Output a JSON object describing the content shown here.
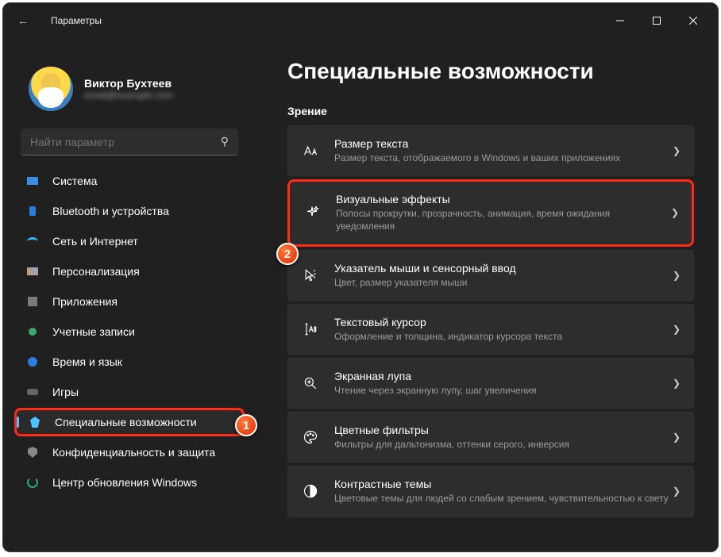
{
  "window": {
    "title": "Параметры"
  },
  "user": {
    "name": "Виктор Бухтеев",
    "email": "email@example.com"
  },
  "search": {
    "placeholder": "Найти параметр"
  },
  "sidebar": {
    "items": [
      {
        "label": "Система"
      },
      {
        "label": "Bluetooth и устройства"
      },
      {
        "label": "Сеть и Интернет"
      },
      {
        "label": "Персонализация"
      },
      {
        "label": "Приложения"
      },
      {
        "label": "Учетные записи"
      },
      {
        "label": "Время и язык"
      },
      {
        "label": "Игры"
      },
      {
        "label": "Специальные возможности"
      },
      {
        "label": "Конфиденциальность и защита"
      },
      {
        "label": "Центр обновления Windows"
      }
    ]
  },
  "page": {
    "heading": "Специальные возможности",
    "section": "Зрение",
    "cards": [
      {
        "title": "Размер текста",
        "sub": "Размер текста, отображаемого в Windows и ваших приложениях"
      },
      {
        "title": "Визуальные эффекты",
        "sub": "Полосы прокрутки, прозрачность, анимация, время ожидания уведомления"
      },
      {
        "title": "Указатель мыши и сенсорный ввод",
        "sub": "Цвет, размер указателя мыши"
      },
      {
        "title": "Текстовый курсор",
        "sub": "Оформление и толщина, индикатор курсора текста"
      },
      {
        "title": "Экранная лупа",
        "sub": "Чтение через экранную лупу, шаг увеличения"
      },
      {
        "title": "Цветные фильтры",
        "sub": "Фильтры для дальтонизма, оттенки серого, инверсия"
      },
      {
        "title": "Контрастные темы",
        "sub": "Цветовые темы для людей со слабым зрением, чувствительностью к свету"
      }
    ]
  },
  "annotations": {
    "badge1": "1",
    "badge2": "2"
  }
}
